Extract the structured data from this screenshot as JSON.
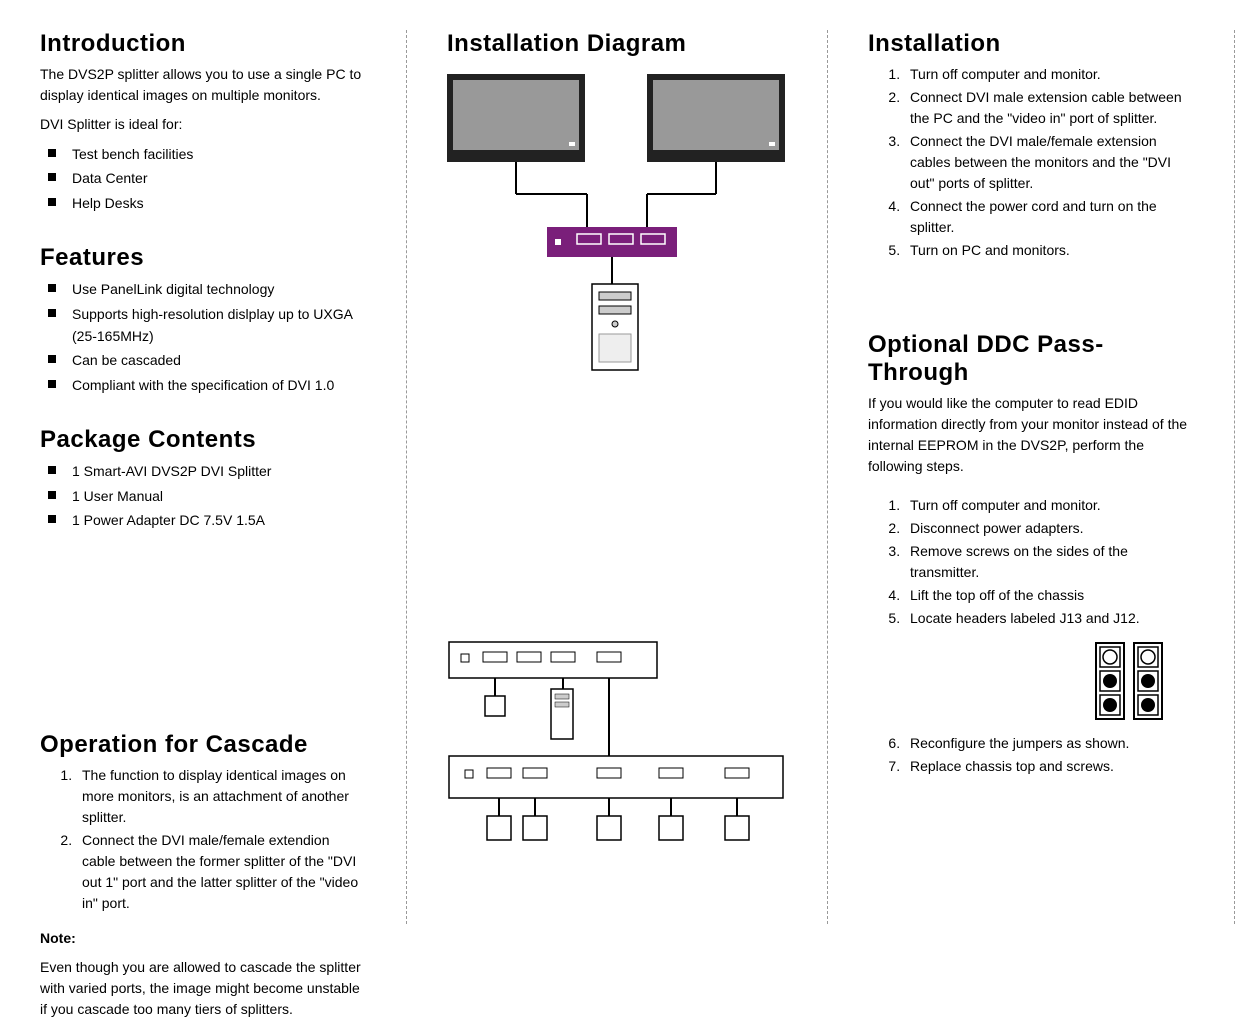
{
  "col1": {
    "introduction": {
      "heading": "Introduction",
      "text": "The DVS2P splitter allows you to use a single PC to display identical images on multiple monitors.",
      "subtext": "DVI Splitter is ideal for:",
      "items": [
        "Test bench facilities",
        "Data Center",
        "Help Desks"
      ]
    },
    "features": {
      "heading": "Features",
      "items": [
        "Use PanelLink digital technology",
        "Supports high-resolution dislplay up to UXGA (25-165MHz)",
        "Can be cascaded",
        "Compliant with the specification of DVI 1.0"
      ]
    },
    "package": {
      "heading": "Package Contents",
      "items": [
        "1 Smart-AVI DVS2P DVI Splitter",
        "1 User Manual",
        "1 Power Adapter DC 7.5V 1.5A"
      ]
    },
    "cascade": {
      "heading": "Operation for Cascade",
      "items": [
        "The function to display identical images on more monitors, is an attachment of another splitter.",
        "Connect the DVI male/female extendion cable between the former splitter of the \"DVI out 1\" port and the latter splitter of the \"video in\" port."
      ],
      "note_label": "Note:",
      "note_text": "Even though you are allowed to cascade the splitter with varied ports, the image might become unstable if you cascade too many tiers of splitters."
    }
  },
  "col2": {
    "heading": "Installation Diagram"
  },
  "col3": {
    "installation": {
      "heading": "Installation",
      "items": [
        "Turn off computer and monitor.",
        "Connect DVI male extension cable between the PC and the \"video in\" port of splitter.",
        "Connect the DVI male/female extension cables between the monitors and the \"DVI out\" ports of splitter.",
        "Connect the power cord and turn on the splitter.",
        "Turn on PC and monitors."
      ]
    },
    "ddc": {
      "heading": "Optional DDC Pass-Through",
      "intro": "If you would like the computer to read EDID information directly from your monitor instead of the internal EEPROM in the DVS2P, perform the following steps.",
      "items_a": [
        "Turn off computer and monitor.",
        "Disconnect power adapters.",
        "Remove screws on the sides of the transmitter.",
        "Lift the top off of the chassis",
        "Locate headers labeled J13 and J12."
      ],
      "items_b": [
        "Reconfigure the jumpers as shown.",
        "Replace chassis top and screws."
      ]
    }
  }
}
